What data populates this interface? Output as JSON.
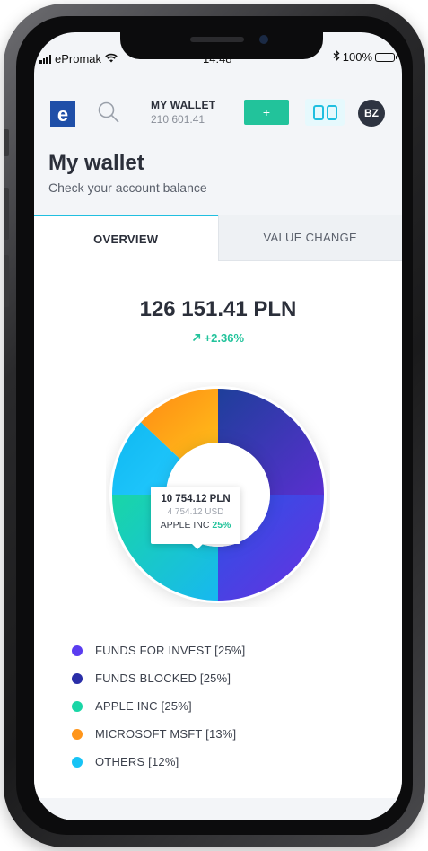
{
  "status_bar": {
    "carrier": "ePromak",
    "time": "14:48",
    "battery": "100%"
  },
  "header": {
    "logo_letter": "e",
    "wallet_title": "MY WALLET",
    "wallet_amount": "210 601.41",
    "add_label": "+",
    "avatar_initials": "BZ"
  },
  "page": {
    "title": "My wallet",
    "subtitle": "Check your account balance"
  },
  "tabs": [
    {
      "label": "OVERVIEW",
      "active": true
    },
    {
      "label": "VALUE CHANGE",
      "active": false
    }
  ],
  "overview": {
    "total": "126 151.41 PLN",
    "change": "+2.36%",
    "change_icon": "arrow-up-right-icon"
  },
  "tooltip": {
    "value": "10 754.12 PLN",
    "usd": "4 754.12 USD",
    "name": "APPLE INC",
    "percent": "25%"
  },
  "chart_data": {
    "type": "pie",
    "donut": true,
    "categories": [
      "FUNDS BLOCKED",
      "FUNDS FOR INVEST",
      "APPLE INC",
      "OTHERS",
      "MICROSOFT MSFT"
    ],
    "values": [
      25,
      25,
      25,
      12,
      13
    ],
    "colors": [
      [
        "#1e3f9a",
        "#5a2fd0"
      ],
      [
        "#2a52e6",
        "#6a30e0"
      ],
      [
        "#19d6a6",
        "#17b8f0"
      ],
      [
        "#0fb8f0",
        "#23c9ff"
      ],
      [
        "#ff8a14",
        "#ffc01a"
      ]
    ]
  },
  "legend": [
    {
      "label": "FUNDS FOR INVEST [25%]",
      "color": "#5a3cf0"
    },
    {
      "label": "FUNDS BLOCKED [25%]",
      "color": "#2a2ea8"
    },
    {
      "label": "APPLE INC [25%]",
      "color": "#19d6a6"
    },
    {
      "label": "MICROSOFT MSFT [13%]",
      "color": "#ff951a"
    },
    {
      "label": "OTHERS [12%]",
      "color": "#17c3f5"
    }
  ]
}
